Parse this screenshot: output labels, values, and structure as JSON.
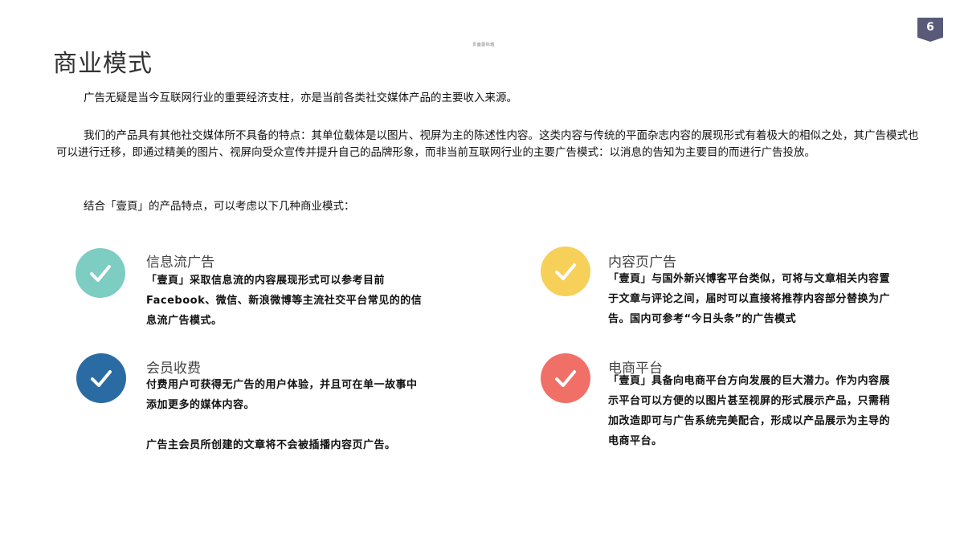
{
  "page_number": "6",
  "watermark": "页面副标题",
  "title": "商业模式",
  "paragraphs": {
    "p1": "广告无疑是当今互联网行业的重要经济支柱，亦是当前各类社交媒体产品的主要收入来源。",
    "p2": "我们的产品具有其他社交媒体所不具备的特点：其单位载体是以图片、视屏为主的陈述性内容。这类内容与传统的平面杂志内容的展现形式有着极大的相似之处，其广告模式也可以进行迁移，即通过精美的图片、视屏向受众宣传并提升自己的品牌形象，而非当前互联网行业的主要广告模式：以消息的告知为主要目的而进行广告投放。",
    "p3": "结合「壹頁」的产品特点，可以考虑以下几种商业模式："
  },
  "items": {
    "feed_ads": {
      "title": "信息流广告",
      "text": "「壹頁」采取信息流的内容展现形式可以参考目前Facebook、微信、新浪微博等主流社交平台常见的的信息流广告模式。",
      "color": "#7dcdc2",
      "icon": "check-icon"
    },
    "content_ads": {
      "title": "内容页广告",
      "text": "「壹頁」与国外新兴博客平台类似，可将与文章相关内容置于文章与评论之间，届时可以直接将推荐内容部分替换为广告。国内可参考“今日头条”的广告模式",
      "color": "#f7d05a",
      "icon": "check-icon"
    },
    "membership": {
      "title": "会员收费",
      "text": "付费用户可获得无广告的用户体验，并且可在单一故事中添加更多的媒体内容。",
      "extra": "广告主会员所创建的文章将不会被插播内容页广告。",
      "color": "#2b6ba4",
      "icon": "check-icon"
    },
    "ecommerce": {
      "title": "电商平台",
      "text": "「壹頁」具备向电商平台方向发展的巨大潜力。作为内容展示平台可以方便的以图片甚至视屏的形式展示产品，只需稍加改造即可与广告系统完美配合，形成以产品展示为主导的电商平台。",
      "color": "#f07068",
      "icon": "check-icon"
    }
  }
}
